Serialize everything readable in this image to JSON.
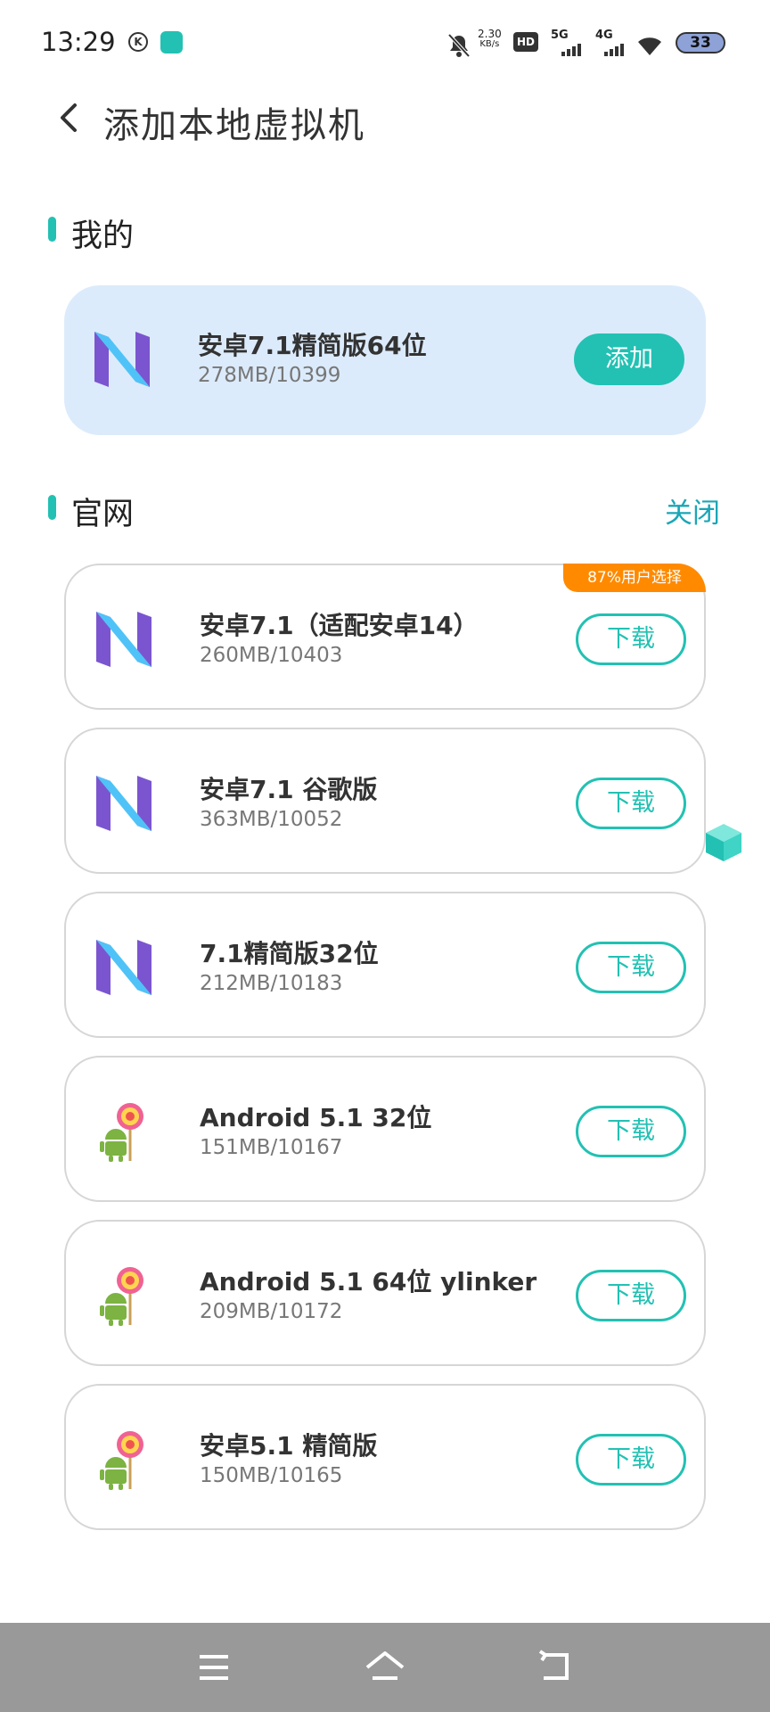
{
  "status_bar": {
    "time": "13:29",
    "k_badge": "K",
    "speed_value": "2.30",
    "speed_unit": "KB/s",
    "hd": "HD",
    "sim1": "5G",
    "sim2": "4G",
    "battery": "33"
  },
  "header": {
    "title": "添加本地虚拟机",
    "back_icon": "chevron-left-icon"
  },
  "mine": {
    "section_title": "我的",
    "item": {
      "name": "安卓7.1精简版64位",
      "sub": "278MB/10399",
      "button": "添加",
      "icon": "android-n-logo-icon"
    }
  },
  "official": {
    "section_title": "官网",
    "action": "关闭",
    "items": [
      {
        "name": "安卓7.1（适配安卓14）",
        "sub": "260MB/10403",
        "button": "下载",
        "badge": "87%用户选择",
        "icon": "android-n-logo-icon"
      },
      {
        "name": "安卓7.1 谷歌版",
        "sub": "363MB/10052",
        "button": "下载",
        "icon": "android-n-logo-icon"
      },
      {
        "name": "7.1精简版32位",
        "sub": "212MB/10183",
        "button": "下载",
        "icon": "android-n-logo-icon"
      },
      {
        "name": "Android 5.1 32位",
        "sub": "151MB/10167",
        "button": "下载",
        "icon": "android-lollipop-icon"
      },
      {
        "name": "Android 5.1 64位 ylinker",
        "sub": "209MB/10172",
        "button": "下载",
        "icon": "android-lollipop-icon"
      },
      {
        "name": "安卓5.1 精简版",
        "sub": "150MB/10165",
        "button": "下载",
        "icon": "android-lollipop-icon"
      }
    ]
  },
  "colors": {
    "accent": "#22c1b3",
    "link": "#1aa6b6",
    "badge": "#ff8a00",
    "mine_bg": "#dcebfb"
  }
}
